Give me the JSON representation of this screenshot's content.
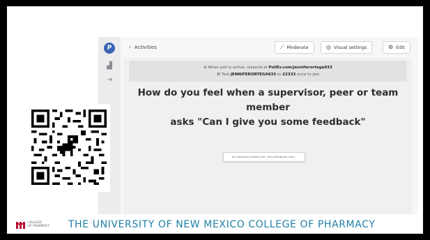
{
  "app": {
    "back_label": "Activities",
    "buttons": {
      "moderate": "Moderate",
      "visual_settings": "Visual settings",
      "edit": "Edit"
    },
    "instructions": {
      "line1_prefix": "When poll is active, respond at",
      "line1_url": "PollEv.com/jenniferortega933",
      "line2_prefix": "Text",
      "line2_code": "JENNIFERORTEGA933",
      "line2_mid": "to",
      "line2_number": "22333",
      "line2_suffix": "once to join"
    },
    "question_line1": "How do you feel when a supervisor, peer or team member",
    "question_line2": "asks \"Can I give you some feedback\"",
    "status_text": "No responses received yet. They will appear here..."
  },
  "footer": {
    "logo_small_line1": "COLLEGE",
    "logo_small_line2": "OF PHARMACY",
    "college_name": "THE UNIVERSITY OF NEW MEXICO COLLEGE OF PHARMACY"
  },
  "colors": {
    "accent": "#3a66b5",
    "footer_text": "#1f7fa6",
    "unm_red": "#ba0c2f"
  },
  "icons": {
    "rail_logo": "pollev-logo-icon",
    "rail_chart": "bar-chart-icon",
    "rail_exit": "exit-icon",
    "moderate": "magic-wand-icon",
    "visual_settings": "palette-icon",
    "edit": "gear-icon",
    "back": "chevron-left-icon"
  }
}
